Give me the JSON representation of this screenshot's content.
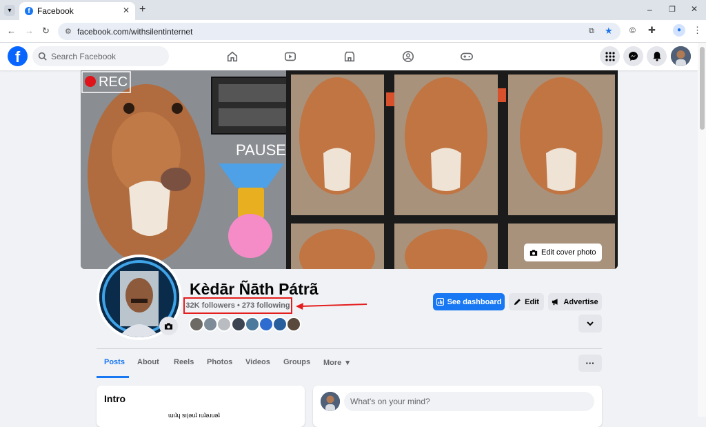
{
  "browser": {
    "tab_title": "Facebook",
    "tab_close": "✕",
    "new_tab": "+",
    "url": "facebook.com/withsilentinternet",
    "window_controls": [
      "–",
      "❐",
      "✕"
    ]
  },
  "fb_header": {
    "logo": "f",
    "search_placeholder": "Search Facebook",
    "nav_icons": [
      "home-icon",
      "video-icon",
      "marketplace-icon",
      "groups-icon",
      "gaming-icon"
    ]
  },
  "cover": {
    "rec_label": "REC",
    "pause_label": "PAUSE",
    "edit_cover_label": "Edit cover photo"
  },
  "profile": {
    "name": "Kèdār Ñāth Pátrã",
    "stats": "32K followers • 273 following"
  },
  "actions": {
    "dashboard_label": "See dashboard",
    "edit_label": "Edit",
    "advertise_label": "Advertise"
  },
  "tabs": [
    "Posts",
    "About",
    "Reels",
    "Photos",
    "Videos",
    "Groups",
    "More"
  ],
  "more_caret": "▾",
  "dots_label": "···",
  "intro": {
    "title": "Intro",
    "bio_partial": "ɯıʇɥ sıןǝuʇ ıuʇǝɹuǝʇ"
  },
  "composer": {
    "placeholder": "What's on your mind?"
  },
  "colors": {
    "fb_blue": "#1877f2",
    "highlight_red": "#e41e1e"
  }
}
